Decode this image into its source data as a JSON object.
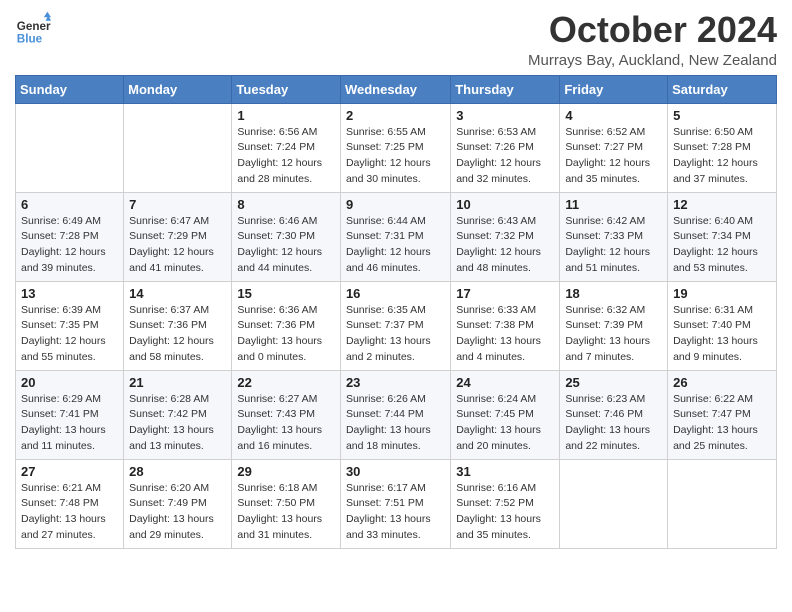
{
  "header": {
    "logo_line1": "General",
    "logo_line2": "Blue",
    "month": "October 2024",
    "location": "Murrays Bay, Auckland, New Zealand"
  },
  "weekdays": [
    "Sunday",
    "Monday",
    "Tuesday",
    "Wednesday",
    "Thursday",
    "Friday",
    "Saturday"
  ],
  "weeks": [
    [
      {
        "day": "",
        "sunrise": "",
        "sunset": "",
        "daylight": ""
      },
      {
        "day": "",
        "sunrise": "",
        "sunset": "",
        "daylight": ""
      },
      {
        "day": "1",
        "sunrise": "Sunrise: 6:56 AM",
        "sunset": "Sunset: 7:24 PM",
        "daylight": "Daylight: 12 hours and 28 minutes."
      },
      {
        "day": "2",
        "sunrise": "Sunrise: 6:55 AM",
        "sunset": "Sunset: 7:25 PM",
        "daylight": "Daylight: 12 hours and 30 minutes."
      },
      {
        "day": "3",
        "sunrise": "Sunrise: 6:53 AM",
        "sunset": "Sunset: 7:26 PM",
        "daylight": "Daylight: 12 hours and 32 minutes."
      },
      {
        "day": "4",
        "sunrise": "Sunrise: 6:52 AM",
        "sunset": "Sunset: 7:27 PM",
        "daylight": "Daylight: 12 hours and 35 minutes."
      },
      {
        "day": "5",
        "sunrise": "Sunrise: 6:50 AM",
        "sunset": "Sunset: 7:28 PM",
        "daylight": "Daylight: 12 hours and 37 minutes."
      }
    ],
    [
      {
        "day": "6",
        "sunrise": "Sunrise: 6:49 AM",
        "sunset": "Sunset: 7:28 PM",
        "daylight": "Daylight: 12 hours and 39 minutes."
      },
      {
        "day": "7",
        "sunrise": "Sunrise: 6:47 AM",
        "sunset": "Sunset: 7:29 PM",
        "daylight": "Daylight: 12 hours and 41 minutes."
      },
      {
        "day": "8",
        "sunrise": "Sunrise: 6:46 AM",
        "sunset": "Sunset: 7:30 PM",
        "daylight": "Daylight: 12 hours and 44 minutes."
      },
      {
        "day": "9",
        "sunrise": "Sunrise: 6:44 AM",
        "sunset": "Sunset: 7:31 PM",
        "daylight": "Daylight: 12 hours and 46 minutes."
      },
      {
        "day": "10",
        "sunrise": "Sunrise: 6:43 AM",
        "sunset": "Sunset: 7:32 PM",
        "daylight": "Daylight: 12 hours and 48 minutes."
      },
      {
        "day": "11",
        "sunrise": "Sunrise: 6:42 AM",
        "sunset": "Sunset: 7:33 PM",
        "daylight": "Daylight: 12 hours and 51 minutes."
      },
      {
        "day": "12",
        "sunrise": "Sunrise: 6:40 AM",
        "sunset": "Sunset: 7:34 PM",
        "daylight": "Daylight: 12 hours and 53 minutes."
      }
    ],
    [
      {
        "day": "13",
        "sunrise": "Sunrise: 6:39 AM",
        "sunset": "Sunset: 7:35 PM",
        "daylight": "Daylight: 12 hours and 55 minutes."
      },
      {
        "day": "14",
        "sunrise": "Sunrise: 6:37 AM",
        "sunset": "Sunset: 7:36 PM",
        "daylight": "Daylight: 12 hours and 58 minutes."
      },
      {
        "day": "15",
        "sunrise": "Sunrise: 6:36 AM",
        "sunset": "Sunset: 7:36 PM",
        "daylight": "Daylight: 13 hours and 0 minutes."
      },
      {
        "day": "16",
        "sunrise": "Sunrise: 6:35 AM",
        "sunset": "Sunset: 7:37 PM",
        "daylight": "Daylight: 13 hours and 2 minutes."
      },
      {
        "day": "17",
        "sunrise": "Sunrise: 6:33 AM",
        "sunset": "Sunset: 7:38 PM",
        "daylight": "Daylight: 13 hours and 4 minutes."
      },
      {
        "day": "18",
        "sunrise": "Sunrise: 6:32 AM",
        "sunset": "Sunset: 7:39 PM",
        "daylight": "Daylight: 13 hours and 7 minutes."
      },
      {
        "day": "19",
        "sunrise": "Sunrise: 6:31 AM",
        "sunset": "Sunset: 7:40 PM",
        "daylight": "Daylight: 13 hours and 9 minutes."
      }
    ],
    [
      {
        "day": "20",
        "sunrise": "Sunrise: 6:29 AM",
        "sunset": "Sunset: 7:41 PM",
        "daylight": "Daylight: 13 hours and 11 minutes."
      },
      {
        "day": "21",
        "sunrise": "Sunrise: 6:28 AM",
        "sunset": "Sunset: 7:42 PM",
        "daylight": "Daylight: 13 hours and 13 minutes."
      },
      {
        "day": "22",
        "sunrise": "Sunrise: 6:27 AM",
        "sunset": "Sunset: 7:43 PM",
        "daylight": "Daylight: 13 hours and 16 minutes."
      },
      {
        "day": "23",
        "sunrise": "Sunrise: 6:26 AM",
        "sunset": "Sunset: 7:44 PM",
        "daylight": "Daylight: 13 hours and 18 minutes."
      },
      {
        "day": "24",
        "sunrise": "Sunrise: 6:24 AM",
        "sunset": "Sunset: 7:45 PM",
        "daylight": "Daylight: 13 hours and 20 minutes."
      },
      {
        "day": "25",
        "sunrise": "Sunrise: 6:23 AM",
        "sunset": "Sunset: 7:46 PM",
        "daylight": "Daylight: 13 hours and 22 minutes."
      },
      {
        "day": "26",
        "sunrise": "Sunrise: 6:22 AM",
        "sunset": "Sunset: 7:47 PM",
        "daylight": "Daylight: 13 hours and 25 minutes."
      }
    ],
    [
      {
        "day": "27",
        "sunrise": "Sunrise: 6:21 AM",
        "sunset": "Sunset: 7:48 PM",
        "daylight": "Daylight: 13 hours and 27 minutes."
      },
      {
        "day": "28",
        "sunrise": "Sunrise: 6:20 AM",
        "sunset": "Sunset: 7:49 PM",
        "daylight": "Daylight: 13 hours and 29 minutes."
      },
      {
        "day": "29",
        "sunrise": "Sunrise: 6:18 AM",
        "sunset": "Sunset: 7:50 PM",
        "daylight": "Daylight: 13 hours and 31 minutes."
      },
      {
        "day": "30",
        "sunrise": "Sunrise: 6:17 AM",
        "sunset": "Sunset: 7:51 PM",
        "daylight": "Daylight: 13 hours and 33 minutes."
      },
      {
        "day": "31",
        "sunrise": "Sunrise: 6:16 AM",
        "sunset": "Sunset: 7:52 PM",
        "daylight": "Daylight: 13 hours and 35 minutes."
      },
      {
        "day": "",
        "sunrise": "",
        "sunset": "",
        "daylight": ""
      },
      {
        "day": "",
        "sunrise": "",
        "sunset": "",
        "daylight": ""
      }
    ]
  ]
}
